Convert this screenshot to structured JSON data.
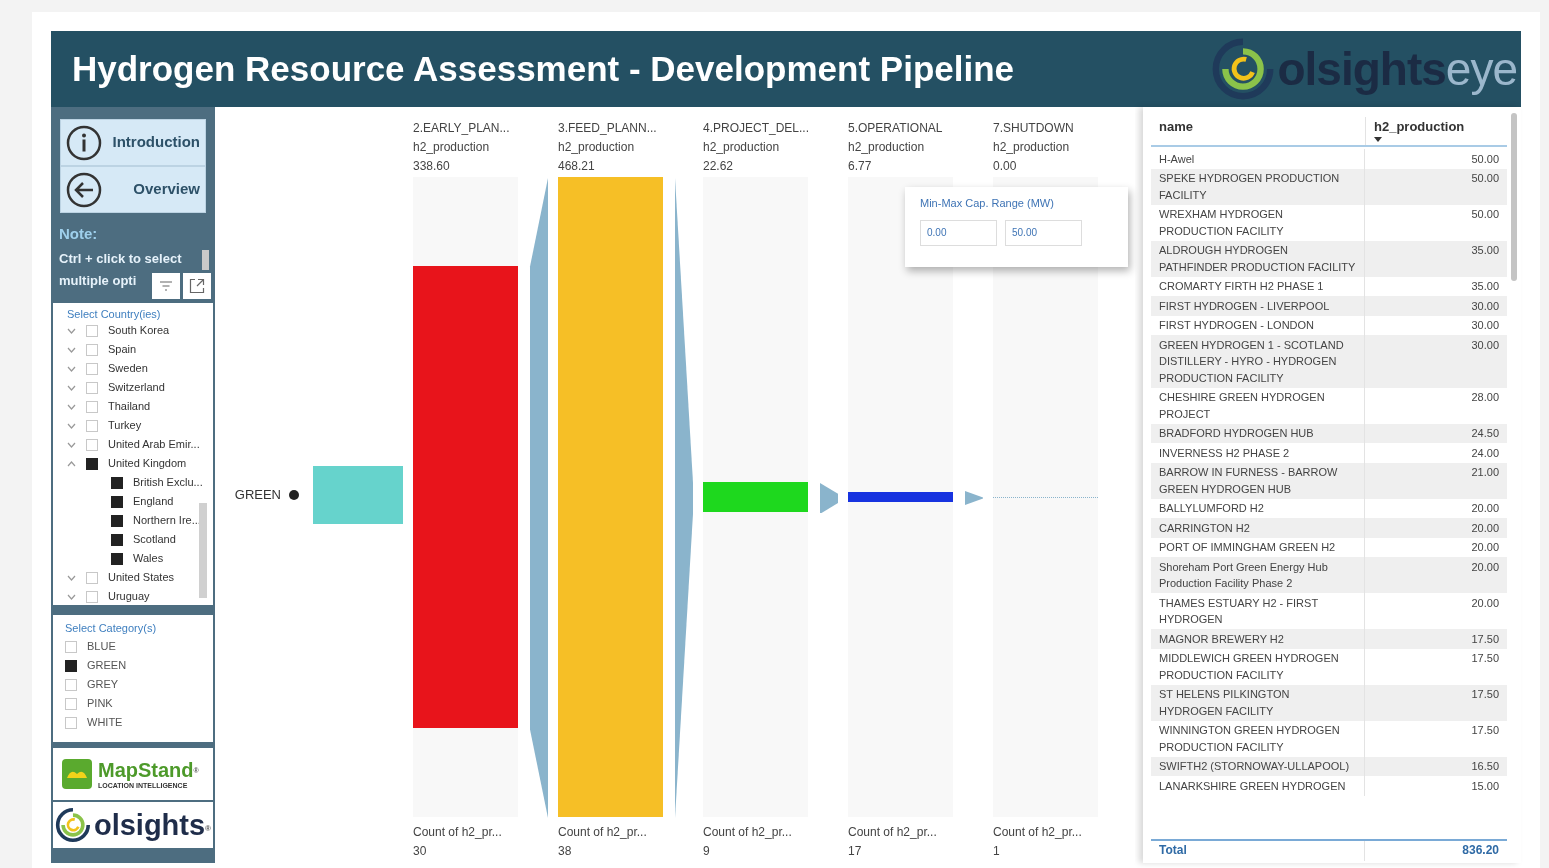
{
  "header": {
    "title": "Hydrogen Resource Assessment - Development Pipeline",
    "logo": {
      "primary": "olsights",
      "secondary": "eye"
    }
  },
  "sidebar": {
    "nav_buttons": [
      {
        "kind": "info",
        "label": "Introduction"
      },
      {
        "kind": "back",
        "label": "Overview"
      }
    ],
    "note": {
      "title": "Note:",
      "lines": [
        "Ctrl + click to select",
        "multiple opti"
      ]
    },
    "country_slicer": {
      "title": "Select Country(ies)",
      "items": [
        {
          "label": "South Korea",
          "checked": false,
          "expanded": false
        },
        {
          "label": "Spain",
          "checked": false,
          "expanded": false
        },
        {
          "label": "Sweden",
          "checked": false,
          "expanded": false
        },
        {
          "label": "Switzerland",
          "checked": false,
          "expanded": false
        },
        {
          "label": "Thailand",
          "checked": false,
          "expanded": false
        },
        {
          "label": "Turkey",
          "checked": false,
          "expanded": false
        },
        {
          "label": "United Arab Emir...",
          "checked": false,
          "expanded": false
        },
        {
          "label": "United Kingdom",
          "checked": true,
          "expanded": true,
          "children": [
            {
              "label": "British Exclu...",
              "checked": true
            },
            {
              "label": "England",
              "checked": true
            },
            {
              "label": "Northern Ire...",
              "checked": true
            },
            {
              "label": "Scotland",
              "checked": true
            },
            {
              "label": "Wales",
              "checked": true
            }
          ]
        },
        {
          "label": "United States",
          "checked": false,
          "expanded": false
        },
        {
          "label": "Uruguay",
          "checked": false,
          "expanded": false
        }
      ]
    },
    "category_slicer": {
      "title": "Select Category(s)",
      "items": [
        {
          "label": "BLUE",
          "checked": false
        },
        {
          "label": "GREEN",
          "checked": true
        },
        {
          "label": "GREY",
          "checked": false
        },
        {
          "label": "PINK",
          "checked": false
        },
        {
          "label": "WHITE",
          "checked": false
        }
      ]
    },
    "partner_logos": [
      {
        "kind": "mapstand",
        "name": "MapStand",
        "mark": "®",
        "tagline": "LOCATION INTELLIGENCE"
      },
      {
        "kind": "olsights",
        "name": "olsights",
        "mark": "®"
      }
    ]
  },
  "funnel": {
    "root": {
      "label": "GREEN",
      "color": "#66d3cc"
    },
    "stages": [
      {
        "name": "2.EARLY_PLAN...",
        "measure": "h2_production",
        "value": "338.60",
        "color": "#e8141b",
        "count_label": "Count of h2_pr...",
        "count": "30"
      },
      {
        "name": "3.FEED_PLANN...",
        "measure": "h2_production",
        "value": "468.21",
        "color": "#f6bf26",
        "count_label": "Count of h2_pr...",
        "count": "38"
      },
      {
        "name": "4.PROJECT_DEL...",
        "measure": "h2_production",
        "value": "22.62",
        "color": "#1ed81e",
        "count_label": "Count of h2_pr...",
        "count": "9"
      },
      {
        "name": "5.OPERATIONAL",
        "measure": "h2_production",
        "value": "6.77",
        "color": "#1733e0",
        "count_label": "Count of h2_pr...",
        "count": "17"
      },
      {
        "name": "7.SHUTDOWN",
        "measure": "h2_production",
        "value": "0.00",
        "color": "#8ab4cc",
        "count_label": "Count of h2_pr...",
        "count": "1"
      }
    ]
  },
  "range_filter": {
    "title": "Min-Max Cap. Range (MW)",
    "min": "0.00",
    "max": "50.00"
  },
  "table": {
    "columns": [
      "name",
      "h2_production"
    ],
    "rows": [
      [
        "H-Awel",
        "50.00"
      ],
      [
        "SPEKE HYDROGEN PRODUCTION FACILITY",
        "50.00"
      ],
      [
        "WREXHAM HYDROGEN PRODUCTION FACILITY",
        "50.00"
      ],
      [
        "ALDROUGH HYDROGEN PATHFINDER PRODUCTION FACILITY",
        "35.00"
      ],
      [
        "CROMARTY FIRTH H2 PHASE 1",
        "35.00"
      ],
      [
        "FIRST HYDROGEN - LIVERPOOL",
        "30.00"
      ],
      [
        "FIRST HYDROGEN - LONDON",
        "30.00"
      ],
      [
        "GREEN HYDROGEN 1 - SCOTLAND DISTILLERY - HYRO - HYDROGEN PRODUCTION FACILITY",
        "30.00"
      ],
      [
        "CHESHIRE GREEN HYDROGEN PROJECT",
        "28.00"
      ],
      [
        "BRADFORD HYDROGEN HUB",
        "24.50"
      ],
      [
        "INVERNESS H2 PHASE 2",
        "24.00"
      ],
      [
        "BARROW IN FURNESS - BARROW GREEN HYDROGEN HUB",
        "21.00"
      ],
      [
        "BALLYLUMFORD H2",
        "20.00"
      ],
      [
        "CARRINGTON H2",
        "20.00"
      ],
      [
        "PORT OF IMMINGHAM GREEN H2",
        "20.00"
      ],
      [
        "Shoreham Port Green Energy Hub Production Facility Phase 2",
        "20.00"
      ],
      [
        "THAMES ESTUARY H2 - FIRST HYDROGEN",
        "20.00"
      ],
      [
        "MAGNOR BREWERY H2",
        "17.50"
      ],
      [
        "MIDDLEWICH GREEN HYDROGEN PRODUCTION FACILITY",
        "17.50"
      ],
      [
        "ST HELENS PILKINGTON HYDROGEN FACILITY",
        "17.50"
      ],
      [
        "WINNINGTON GREEN HYDROGEN PRODUCTION FACILITY",
        "17.50"
      ],
      [
        "SWIFTH2 (STORNOWAY-ULLAPOOL)",
        "16.50"
      ],
      [
        "LANARKSHIRE GREEN HYDROGEN",
        "15.00"
      ]
    ],
    "total": {
      "label": "Total",
      "value": "836.20"
    }
  }
}
